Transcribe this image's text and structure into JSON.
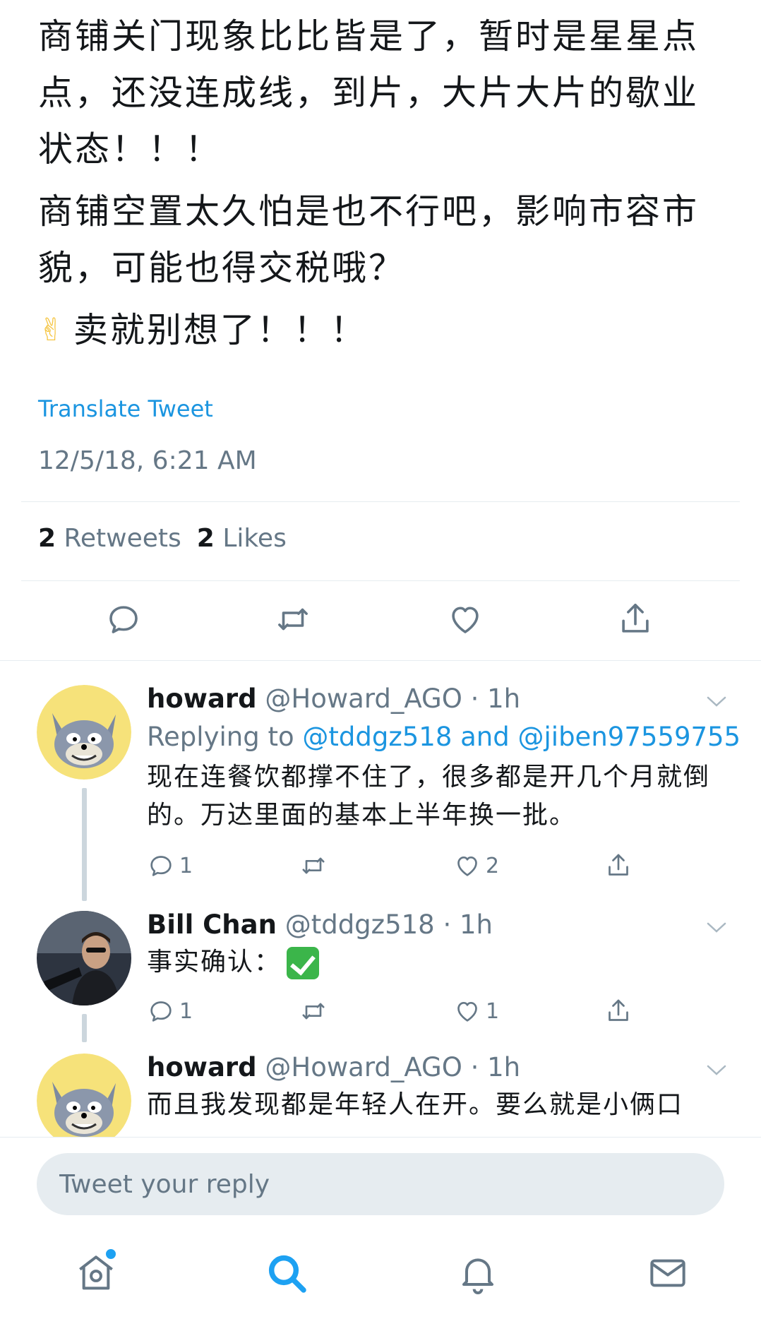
{
  "tweet": {
    "paragraphs": [
      "商铺关门现象比比皆是了，暂时是星星点点，还没连成线，到片，大片大片的歇业状态！！！",
      "商铺空置太久怕是也不行吧，影响市容市貌，可能也得交税哦？",
      "卖就别想了！！！"
    ],
    "emoji": "peace-hand-emoji",
    "translate_label": "Translate Tweet",
    "timestamp": "12/5/18, 6:21 AM",
    "retweets_count": "2",
    "retweets_label": "Retweets",
    "likes_count": "2",
    "likes_label": "Likes"
  },
  "actions": [
    {
      "icon": "reply-icon"
    },
    {
      "icon": "retweet-icon"
    },
    {
      "icon": "like-icon"
    },
    {
      "icon": "share-icon"
    }
  ],
  "replies": [
    {
      "name": "howard",
      "handle": "@Howard_AGO · 1h",
      "replying_prefix": "Replying to ",
      "replying_mention_1": "@tddgz518",
      "replying_and": " and ",
      "replying_mention_2": "@jiben97559755",
      "text": "现在连餐饮都撑不住了，很多都是开几个月就倒的。万达里面的基本上半年换一批。",
      "reply_count": "1",
      "like_count": "2",
      "avatar": "cartoon-cat-avatar"
    },
    {
      "name": "Bill Chan",
      "handle": "@tddgz518 · 1h",
      "text": "事实确认：",
      "emoji": "check-mark-emoji",
      "reply_count": "1",
      "like_count": "1",
      "avatar": "man-photo-avatar"
    },
    {
      "name": "howard",
      "handle": "@Howard_AGO · 1h",
      "text": "而且我发现都是年轻人在开。要么就是小俩口",
      "avatar": "cartoon-cat-avatar"
    }
  ],
  "reply_bar": {
    "placeholder": "Tweet your reply"
  },
  "tabbar": [
    {
      "icon": "home-icon"
    },
    {
      "icon": "search-icon"
    },
    {
      "icon": "notifications-icon"
    },
    {
      "icon": "messages-icon"
    }
  ],
  "colors": {
    "accent": "#1da1f2",
    "link": "#1b95e0",
    "secondary_text": "#657786",
    "primary_text": "#14171a"
  }
}
